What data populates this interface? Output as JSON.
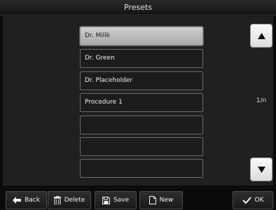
{
  "window": {
    "title": "Presets"
  },
  "presets": {
    "items": [
      {
        "label": "Dr. Milik",
        "selected": true
      },
      {
        "label": "Dr. Green",
        "selected": false
      },
      {
        "label": "Dr. Placeholder",
        "selected": false
      },
      {
        "label": "Procedure 1",
        "selected": false
      },
      {
        "label": "",
        "selected": false
      },
      {
        "label": "",
        "selected": false
      },
      {
        "label": "",
        "selected": false
      }
    ],
    "page_indicator": "1/n"
  },
  "scroll": {
    "up_icon": "triangle-up-icon",
    "down_icon": "triangle-down-icon"
  },
  "toolbar": {
    "back_label": "Back",
    "delete_label": "Delete",
    "save_label": "Save",
    "new_label": "New",
    "ok_label": "OK",
    "icons": {
      "back": "arrow-left-icon",
      "delete": "trash-icon",
      "save": "floppy-disk-icon",
      "new": "document-icon",
      "ok": "checkmark-icon"
    }
  },
  "colors": {
    "background": "#0b0b0b",
    "panel": "#202020",
    "selected_item": "#c0c0c0",
    "scroll_button": "#f0f0f0"
  }
}
